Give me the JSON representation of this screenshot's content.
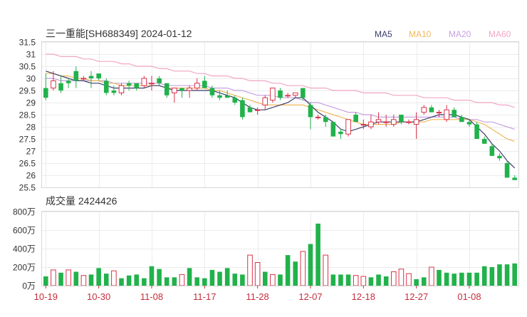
{
  "chart_data": [
    {
      "type": "candlestick",
      "title": "三一重能[SH688349] 2024-01-12",
      "legend": [
        {
          "name": "MA5",
          "color": "#3a3f6b"
        },
        {
          "name": "MA10",
          "color": "#f0b85a"
        },
        {
          "name": "MA20",
          "color": "#c9a0e0"
        },
        {
          "name": "MA60",
          "color": "#f2a6c6"
        }
      ],
      "y_ticks": [
        "25.5",
        "26",
        "26.5",
        "27",
        "27.5",
        "28",
        "28.5",
        "29",
        "29.5",
        "30",
        "30.5",
        "31",
        "31.5"
      ],
      "ylim": [
        25.5,
        31.5
      ],
      "up_color": "#d8344a",
      "down_color": "#21b24b",
      "ohlc": [
        [
          29.6,
          30.2,
          29.1,
          29.2
        ],
        [
          29.6,
          30.3,
          29.5,
          29.9
        ],
        [
          29.8,
          30.1,
          29.4,
          29.5
        ],
        [
          29.9,
          30.0,
          29.6,
          29.8
        ],
        [
          30.3,
          30.5,
          29.6,
          29.9
        ],
        [
          30.0,
          30.1,
          29.9,
          30.0
        ],
        [
          30.1,
          30.3,
          29.6,
          30.0
        ],
        [
          30.2,
          30.2,
          29.9,
          30.0
        ],
        [
          29.9,
          30.0,
          29.3,
          29.4
        ],
        [
          29.5,
          29.7,
          29.3,
          29.4
        ],
        [
          29.4,
          29.8,
          29.3,
          29.7
        ],
        [
          29.8,
          29.9,
          29.5,
          29.7
        ],
        [
          29.8,
          29.8,
          29.5,
          29.6
        ],
        [
          29.7,
          30.1,
          29.6,
          30.0
        ],
        [
          29.8,
          30.1,
          29.5,
          29.8
        ],
        [
          30.0,
          30.1,
          29.7,
          29.8
        ],
        [
          29.8,
          29.8,
          29.2,
          29.3
        ],
        [
          29.4,
          29.6,
          29.0,
          29.6
        ],
        [
          29.6,
          29.6,
          29.2,
          29.5
        ],
        [
          29.5,
          29.7,
          29.2,
          29.6
        ],
        [
          29.6,
          30.0,
          29.5,
          29.8
        ],
        [
          29.9,
          30.1,
          29.6,
          29.6
        ],
        [
          29.6,
          29.7,
          29.2,
          29.3
        ],
        [
          29.3,
          29.5,
          29.1,
          29.2
        ],
        [
          29.3,
          29.5,
          29.2,
          29.2
        ],
        [
          29.2,
          29.3,
          28.9,
          29.0
        ],
        [
          29.1,
          29.2,
          28.3,
          28.4
        ],
        [
          28.8,
          28.9,
          28.6,
          28.6
        ],
        [
          28.7,
          28.8,
          28.5,
          28.7
        ],
        [
          28.9,
          29.3,
          28.7,
          29.2
        ],
        [
          29.1,
          29.6,
          29.0,
          29.6
        ],
        [
          29.5,
          29.6,
          29.1,
          29.2
        ],
        [
          29.3,
          29.4,
          29.2,
          29.3
        ],
        [
          29.3,
          29.4,
          29.2,
          29.4
        ],
        [
          29.6,
          29.6,
          29.1,
          29.2
        ],
        [
          28.9,
          29.0,
          27.9,
          28.4
        ],
        [
          28.4,
          28.5,
          28.3,
          28.4
        ],
        [
          28.4,
          28.5,
          28.0,
          28.2
        ],
        [
          28.2,
          28.2,
          27.6,
          27.6
        ],
        [
          27.8,
          27.9,
          27.5,
          27.7
        ],
        [
          27.7,
          28.3,
          27.6,
          28.3
        ],
        [
          28.5,
          28.6,
          28.2,
          28.2
        ],
        [
          28.1,
          28.3,
          27.9,
          28.1
        ],
        [
          28.0,
          28.5,
          27.9,
          28.2
        ],
        [
          28.2,
          28.6,
          28.1,
          28.3
        ],
        [
          28.2,
          28.5,
          28.0,
          28.2
        ],
        [
          28.1,
          28.5,
          28.0,
          28.3
        ],
        [
          28.5,
          28.5,
          28.1,
          28.2
        ],
        [
          28.2,
          28.3,
          28.1,
          28.2
        ],
        [
          28.1,
          28.6,
          27.5,
          28.3
        ],
        [
          28.6,
          28.9,
          28.5,
          28.8
        ],
        [
          28.8,
          28.9,
          28.6,
          28.6
        ],
        [
          28.6,
          28.7,
          28.4,
          28.6
        ],
        [
          28.3,
          28.9,
          28.2,
          28.7
        ],
        [
          28.7,
          28.8,
          28.4,
          28.4
        ],
        [
          28.4,
          28.5,
          28.2,
          28.2
        ],
        [
          28.2,
          28.3,
          28.0,
          28.1
        ],
        [
          28.1,
          28.2,
          27.5,
          27.5
        ],
        [
          27.5,
          27.6,
          27.3,
          27.3
        ],
        [
          27.2,
          27.3,
          26.8,
          26.8
        ],
        [
          26.8,
          26.9,
          26.6,
          26.7
        ],
        [
          26.5,
          26.6,
          25.9,
          25.9
        ],
        [
          25.9,
          26.0,
          25.8,
          25.8
        ]
      ],
      "ma5": [
        30.3,
        30.2,
        30.1,
        30.0,
        29.9,
        29.9,
        29.8,
        29.8,
        29.7,
        29.6,
        29.6,
        29.6,
        29.6,
        29.6,
        29.7,
        29.7,
        29.6,
        29.5,
        29.5,
        29.5,
        29.5,
        29.5,
        29.5,
        29.4,
        29.3,
        29.2,
        29.0,
        28.8,
        28.7,
        28.7,
        28.8,
        28.9,
        29.0,
        29.2,
        29.2,
        28.9,
        28.6,
        28.4,
        28.2,
        27.9,
        27.8,
        27.9,
        28.0,
        28.1,
        28.2,
        28.2,
        28.2,
        28.2,
        28.2,
        28.2,
        28.3,
        28.4,
        28.5,
        28.5,
        28.5,
        28.4,
        28.3,
        28.0,
        27.7,
        27.3,
        27.0,
        26.6,
        26.3
      ],
      "ma10": [
        30.2,
        30.2,
        30.1,
        30.1,
        30.0,
        30.0,
        29.9,
        29.9,
        29.8,
        29.8,
        29.7,
        29.7,
        29.7,
        29.7,
        29.7,
        29.7,
        29.6,
        29.6,
        29.6,
        29.6,
        29.6,
        29.6,
        29.5,
        29.5,
        29.4,
        29.3,
        29.2,
        29.1,
        29.0,
        28.9,
        28.9,
        28.9,
        28.9,
        28.9,
        28.9,
        28.8,
        28.7,
        28.6,
        28.5,
        28.4,
        28.3,
        28.2,
        28.1,
        28.1,
        28.1,
        28.1,
        28.1,
        28.2,
        28.2,
        28.2,
        28.2,
        28.3,
        28.3,
        28.3,
        28.3,
        28.3,
        28.3,
        28.2,
        28.1,
        27.9,
        27.7,
        27.5,
        27.4
      ],
      "ma20": [
        30.0,
        30.0,
        29.9,
        29.9,
        29.9,
        29.9,
        29.9,
        29.9,
        29.9,
        29.8,
        29.8,
        29.8,
        29.8,
        29.8,
        29.8,
        29.8,
        29.7,
        29.7,
        29.7,
        29.7,
        29.7,
        29.7,
        29.6,
        29.6,
        29.6,
        29.5,
        29.5,
        29.4,
        29.3,
        29.3,
        29.3,
        29.2,
        29.2,
        29.2,
        29.1,
        29.0,
        29.0,
        28.9,
        28.8,
        28.7,
        28.6,
        28.6,
        28.5,
        28.5,
        28.4,
        28.4,
        28.4,
        28.4,
        28.4,
        28.4,
        28.4,
        28.4,
        28.4,
        28.4,
        28.4,
        28.3,
        28.3,
        28.3,
        28.2,
        28.2,
        28.1,
        28.0,
        27.9
      ],
      "ma60": [
        31.0,
        31.0,
        30.9,
        30.9,
        30.9,
        30.8,
        30.8,
        30.7,
        30.7,
        30.7,
        30.6,
        30.6,
        30.5,
        30.5,
        30.5,
        30.4,
        30.4,
        30.3,
        30.3,
        30.3,
        30.2,
        30.2,
        30.1,
        30.1,
        30.1,
        30.0,
        30.0,
        29.9,
        29.9,
        29.9,
        29.8,
        29.8,
        29.7,
        29.7,
        29.7,
        29.6,
        29.6,
        29.6,
        29.5,
        29.5,
        29.5,
        29.5,
        29.4,
        29.4,
        29.4,
        29.4,
        29.3,
        29.3,
        29.3,
        29.3,
        29.2,
        29.2,
        29.2,
        29.2,
        29.1,
        29.1,
        29.1,
        29.0,
        29.0,
        29.0,
        28.9,
        28.9,
        28.8
      ]
    },
    {
      "type": "bar",
      "title": "成交量 2424426",
      "y_ticks": [
        "0万",
        "200万",
        "400万",
        "600万",
        "800万"
      ],
      "ylim": [
        0,
        8000000
      ],
      "x_ticks": [
        {
          "index": 0,
          "label": "10-19"
        },
        {
          "index": 7,
          "label": "10-30"
        },
        {
          "index": 14,
          "label": "11-08"
        },
        {
          "index": 21,
          "label": "11-17"
        },
        {
          "index": 28,
          "label": "11-28"
        },
        {
          "index": 35,
          "label": "12-07"
        },
        {
          "index": 42,
          "label": "12-18"
        },
        {
          "index": 49,
          "label": "12-27"
        },
        {
          "index": 56,
          "label": "01-08"
        }
      ],
      "values": [
        1000000,
        1700000,
        1400000,
        1700000,
        1500000,
        1100000,
        1200000,
        1900000,
        1300000,
        1600000,
        800000,
        1100000,
        1200000,
        800000,
        2100000,
        1800000,
        900000,
        900000,
        1200000,
        1900000,
        900000,
        800000,
        1700000,
        1500000,
        1900000,
        1300000,
        1200000,
        3300000,
        2500000,
        1500000,
        1200000,
        1200000,
        3300000,
        2600000,
        3700000,
        4500000,
        6700000,
        3300000,
        1200000,
        1200000,
        1200000,
        1100000,
        1000000,
        900000,
        1200000,
        1000000,
        1500000,
        1800000,
        1300000,
        700000,
        900000,
        2000000,
        1700000,
        1400000,
        1300000,
        1400000,
        1400000,
        1400000,
        2100000,
        2000000,
        2300000,
        2300000,
        2400000
      ],
      "volume_up": [
        false,
        true,
        false,
        true,
        false,
        true,
        false,
        false,
        false,
        true,
        false,
        false,
        false,
        false,
        false,
        false,
        false,
        false,
        true,
        false,
        false,
        false,
        false,
        false,
        false,
        false,
        false,
        true,
        true,
        false,
        true,
        false,
        false,
        false,
        true,
        false,
        false,
        true,
        false,
        false,
        false,
        true,
        true,
        false,
        false,
        false,
        true,
        true,
        true,
        false,
        false,
        true,
        false,
        false,
        false,
        false,
        false,
        false,
        false,
        false,
        false,
        false,
        false
      ]
    }
  ]
}
